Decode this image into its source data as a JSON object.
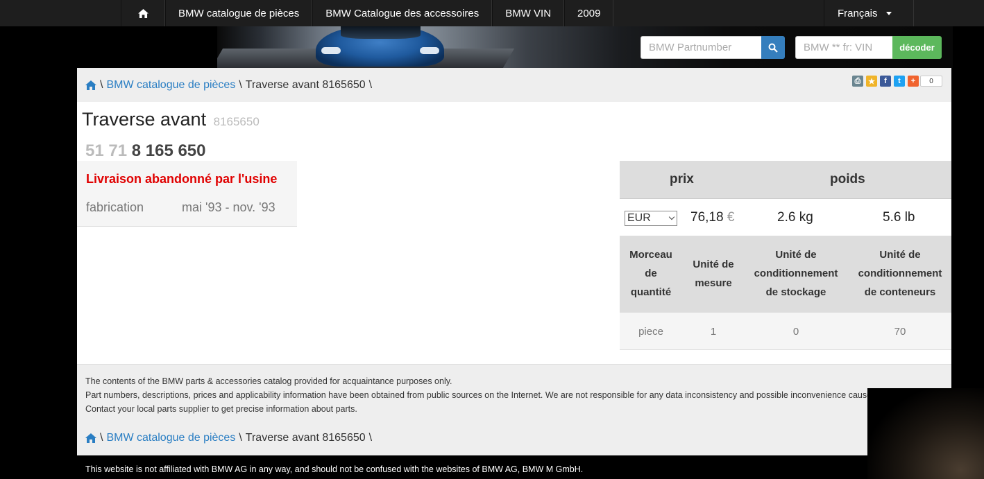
{
  "nav": {
    "items": [
      "BMW catalogue de pièces",
      "BMW Catalogue des accessoires",
      "BMW VIN",
      "2009"
    ],
    "language": "Français"
  },
  "search": {
    "part_placeholder": "BMW Partnumber",
    "vin_placeholder": "BMW ** fr: VIN",
    "decode_label": "décoder"
  },
  "breadcrumb": {
    "sep": "\\",
    "link": "BMW catalogue de pièces",
    "current": "Traverse avant 8165650"
  },
  "share": {
    "count": "0"
  },
  "part": {
    "title": "Traverse avant",
    "number_small": "8165650",
    "number_prefix": "51 71",
    "number_main": "8 165 650",
    "status": "Livraison abandonné par l'usine",
    "fabrication_label": "fabrication",
    "fabrication_value": "mai '93 - nov. '93"
  },
  "pricing": {
    "price_header": "prix",
    "weight_header": "poids",
    "currency": "EUR",
    "price": "76,18",
    "currency_symbol": "€",
    "weight_kg": "2.6 kg",
    "weight_lb": "5.6 lb"
  },
  "packaging": {
    "headers": [
      [
        "Morceau",
        "de",
        "quantité"
      ],
      [
        "Unité de",
        "mesure"
      ],
      [
        "Unité de",
        "conditionnement",
        "de stockage"
      ],
      [
        "Unité de",
        "conditionnement",
        "de conteneurs"
      ]
    ],
    "values": [
      "piece",
      "1",
      "0",
      "70"
    ]
  },
  "disclaimer": [
    "The contents of the BMW parts & accessories catalog provided for acquaintance purposes only.",
    "Part numbers, descriptions, prices and applicability information have been obtained from public sources on the Internet. We are not responsible for any data inconsistency and possible inconvenience caused.",
    "Contact your local parts supplier to get precise information about parts."
  ],
  "affiliation_note": "This website is not affiliated with BMW AG in any way, and should not be confused with the websites of BMW AG, BMW M GmbH.",
  "colors": {
    "link": "#2a7ec3",
    "status_red": "#e00000",
    "search_button": "#357ebd",
    "decode_button": "#5cb85c"
  }
}
